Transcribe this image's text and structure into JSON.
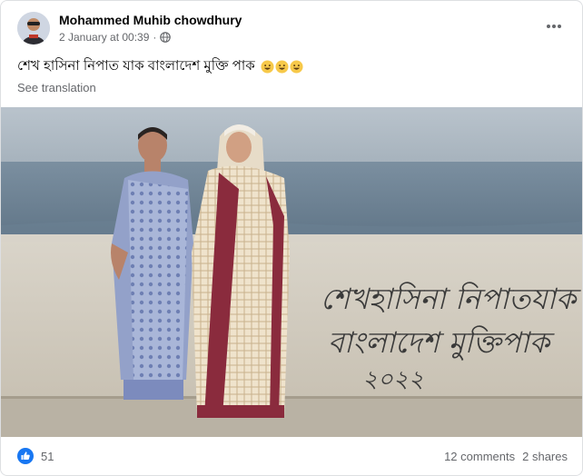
{
  "post": {
    "author": "Mohammed Muhib chowdhury",
    "date": "2 January at 00:39",
    "separator": "·",
    "privacy_icon": "globe-icon",
    "more_icon": "more-options-icon",
    "text": "শেখ হাসিনা নিপাত যাক বাংলাদেশ মুক্তি পাক",
    "emojis": [
      "grinning-face-emoji",
      "grinning-face-emoji",
      "grinning-face-emoji"
    ],
    "see_translation": "See translation"
  },
  "photo": {
    "wall_text_line1": "শেখহাসিনা নিপাতযাক",
    "wall_text_line2": "বাংলাদেশ মুক্তিপাক",
    "wall_text_line3": "২০২২"
  },
  "footer": {
    "like_icon": "like-reaction-icon",
    "reaction_count": "51",
    "comments": "12 comments",
    "shares": "2 shares"
  },
  "colors": {
    "like_blue": "#1877f2",
    "secondary_text": "#65676b",
    "primary_text": "#050505"
  }
}
